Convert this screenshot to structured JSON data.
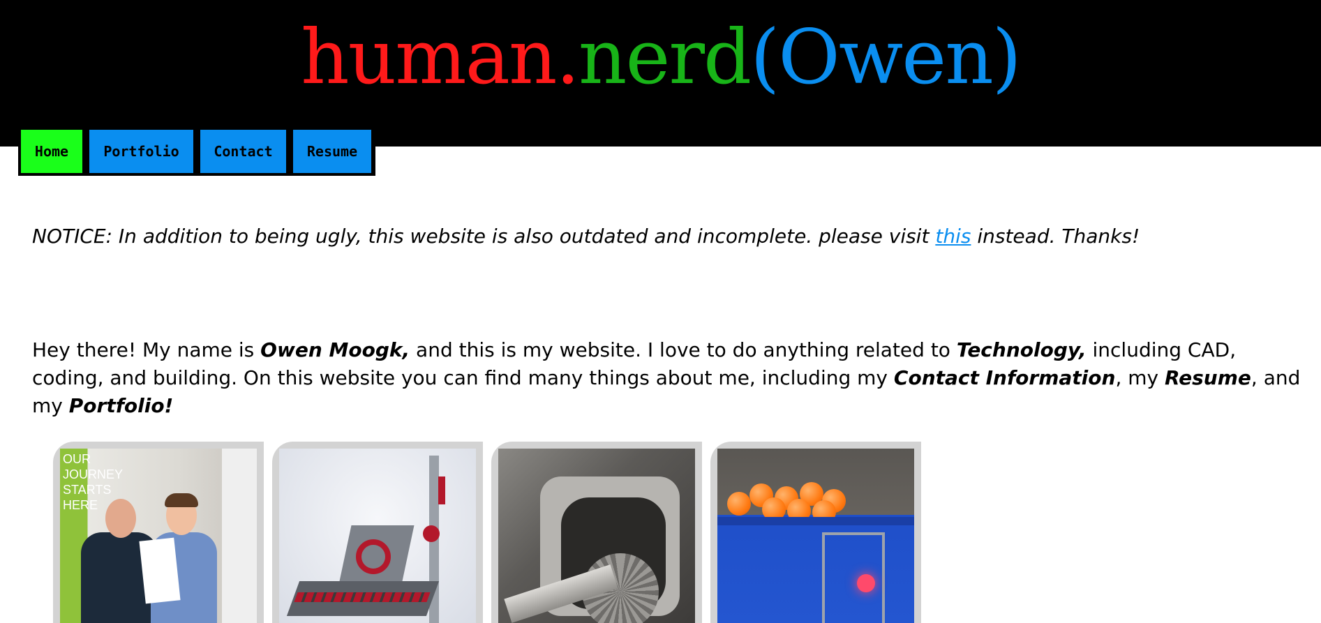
{
  "header": {
    "logo_part1": "human.",
    "logo_part2": "nerd",
    "logo_part3": "(Owen)"
  },
  "nav": {
    "items": [
      {
        "label": "Home",
        "active": true
      },
      {
        "label": "Portfolio",
        "active": false
      },
      {
        "label": "Contact",
        "active": false
      },
      {
        "label": "Resume",
        "active": false
      }
    ]
  },
  "notice": {
    "before": "NOTICE: In addition to being ugly, this website is also outdated and incomplete. please visit ",
    "link_text": "this",
    "after": " instead. Thanks!"
  },
  "intro": {
    "t1": "Hey there! My name is ",
    "name": "Owen Moogk,",
    "t2": " and this is my website. I love to do anything related to ",
    "technology": "Technology,",
    "t3": " including CAD, coding, and building. On this website you can find many things about me, including my ",
    "contact": "Contact Information",
    "t4": ", my ",
    "resume": "Resume",
    "t5": ", and my ",
    "portfolio": "Portfolio!"
  },
  "gallery": {
    "card1_sign_text": "OUR\nJOURNEY\nSTARTS\nHERE"
  },
  "colors": {
    "header_bg": "#000000",
    "logo_red": "#ff1a1a",
    "logo_green": "#18b418",
    "logo_blue": "#0a8ef0",
    "nav_active": "#1aff1a",
    "nav_default": "#0a8ef0",
    "card_frame": "#d3d3d3"
  }
}
